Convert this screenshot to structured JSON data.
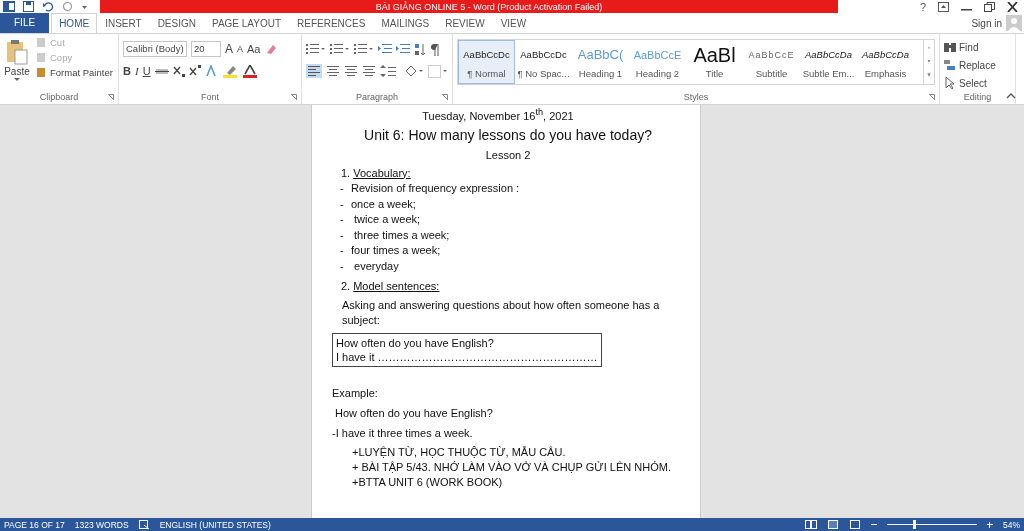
{
  "title_bar": {
    "title": "BÀI GIẢNG ONLINE 5 -  Word (Product Activation Failed)",
    "help": "?"
  },
  "tabs": [
    {
      "label": "FILE",
      "kind": "file",
      "selected": false
    },
    {
      "label": "HOME",
      "kind": "tab",
      "selected": true
    },
    {
      "label": "INSERT",
      "kind": "tab",
      "selected": false
    },
    {
      "label": "DESIGN",
      "kind": "tab",
      "selected": false
    },
    {
      "label": "PAGE LAYOUT",
      "kind": "tab",
      "selected": false
    },
    {
      "label": "REFERENCES",
      "kind": "tab",
      "selected": false
    },
    {
      "label": "MAILINGS",
      "kind": "tab",
      "selected": false
    },
    {
      "label": "REVIEW",
      "kind": "tab",
      "selected": false
    },
    {
      "label": "VIEW",
      "kind": "tab",
      "selected": false
    }
  ],
  "sign_in": "Sign in",
  "clipboard": {
    "label": "Clipboard",
    "paste": "Paste",
    "items": [
      {
        "label": "Cut",
        "disabled": true
      },
      {
        "label": "Copy",
        "disabled": true
      },
      {
        "label": "Format Painter",
        "disabled": false
      }
    ]
  },
  "font": {
    "label": "Font",
    "font_name": "Calibri (Body)",
    "font_size": "20",
    "grow": "A",
    "shrink": "A",
    "change_case": "Aa",
    "bold": "B",
    "italic": "I",
    "underline": "U"
  },
  "paragraph": {
    "label": "Paragraph"
  },
  "styles": {
    "label": "Styles",
    "items": [
      {
        "preview": "AaBbCcDc",
        "name": "¶ Normal",
        "kind": "normal",
        "selected": true
      },
      {
        "preview": "AaBbCcDc",
        "name": "¶ No Spac...",
        "kind": "normal",
        "selected": false
      },
      {
        "preview": "AaBbC(",
        "name": "Heading 1",
        "kind": "heading1",
        "selected": false
      },
      {
        "preview": "AaBbCcE",
        "name": "Heading 2",
        "kind": "heading2",
        "selected": false
      },
      {
        "preview": "AaBl",
        "name": "Title",
        "kind": "title",
        "selected": false
      },
      {
        "preview": "AaBbCcE",
        "name": "Subtitle",
        "kind": "subtitle",
        "selected": false
      },
      {
        "preview": "AaBbCcDa",
        "name": "Subtle Em...",
        "kind": "emphasis",
        "selected": false
      },
      {
        "preview": "AaBbCcDa",
        "name": "Emphasis",
        "kind": "emphasis",
        "selected": false
      }
    ]
  },
  "editing": {
    "label": "Editing",
    "items": [
      {
        "label": "Find",
        "kind": "find"
      },
      {
        "label": "Replace",
        "kind": "replace"
      },
      {
        "label": "Select",
        "kind": "select"
      }
    ]
  },
  "document": [
    {
      "kind": "date",
      "text": "Tuesday, November 16$^{th}$, 2021"
    },
    {
      "kind": "heading",
      "text": "Unit 6: How many lessons do you have today?"
    },
    {
      "kind": "center",
      "text": "Lesson 2"
    },
    {
      "kind": "numbered",
      "number": "1.",
      "text": "Vocabulary:"
    },
    {
      "kind": "dash",
      "marker": "-",
      "text": "Revision of frequency expression :"
    },
    {
      "kind": "dash",
      "marker": "-",
      "text": "once a week;"
    },
    {
      "kind": "dash",
      "marker": "-",
      "text": " twice a week;"
    },
    {
      "kind": "dash",
      "marker": "-",
      "text": " three times a week;"
    },
    {
      "kind": "dash",
      "marker": "-",
      "text": "four times a week;"
    },
    {
      "kind": "dash",
      "marker": "-",
      "text": " everyday"
    },
    {
      "kind": "numbered",
      "number": "2.",
      "text": "Model sentences:"
    },
    {
      "kind": "para",
      "text": "Asking and answering questions about how often someone has a subject:"
    },
    {
      "kind": "box",
      "lines": [
        "How often do you have English?",
        "I have it ……………………………………………………"
      ]
    },
    {
      "kind": "plain",
      "text": "Example:"
    },
    {
      "kind": "plain",
      "text": " How often do you have English?"
    },
    {
      "kind": "plain",
      "text": "-I have it three times a week."
    },
    {
      "kind": "indent",
      "text": "+LUYỆN TỪ, HỌC THUỘC TỪ, MẪU CÂU."
    },
    {
      "kind": "indent",
      "text": "+ BÀI TẬP 5/43. NHỚ LÀM VÀO VỞ VÀ CHỤP GỬI LÊN NHÓM."
    },
    {
      "kind": "indent",
      "text": "+BTTA UNIT 6 (WORK BOOK)"
    }
  ],
  "status_bar": {
    "page": "PAGE 16 OF 17",
    "words": "1323 WORDS",
    "language": "ENGLISH (UNITED STATES)",
    "zoom": {
      "level": 0.3,
      "reading": "54%"
    }
  }
}
